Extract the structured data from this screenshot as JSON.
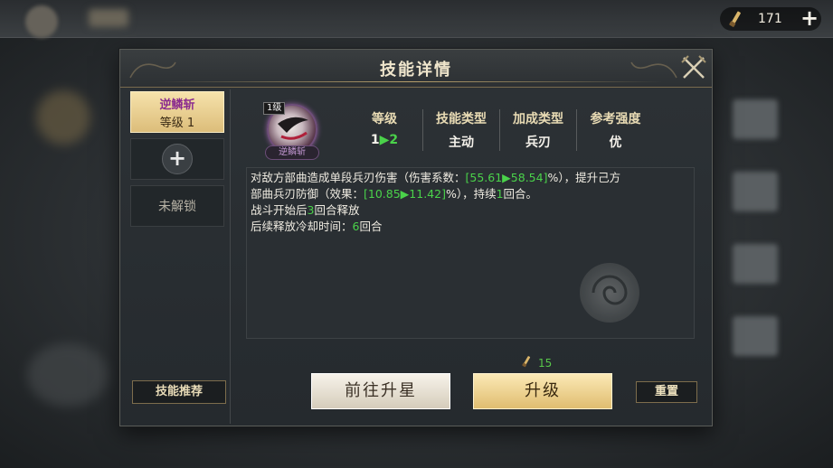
{
  "resource": {
    "icon": "brush-scroll-icon",
    "value": "171",
    "plus": "+"
  },
  "dialog": {
    "title": "技能详情",
    "close_icon": "crossed-blades-close-icon"
  },
  "left_panel": {
    "active_skill": {
      "name": "逆鳞斩",
      "level": "等级 1"
    },
    "add_symbol": "+",
    "locked_label": "未解锁",
    "recommend_label": "技能推荐"
  },
  "skill": {
    "level_badge": "1级",
    "icon_name": "逆鳞斩",
    "stats": [
      {
        "label": "等级",
        "value_from": "1",
        "value_to": "2"
      },
      {
        "label": "技能类型",
        "value": "主动"
      },
      {
        "label": "加成类型",
        "value": "兵刃"
      },
      {
        "label": "参考强度",
        "value": "优"
      }
    ],
    "description": {
      "line1_a": "对敌方部曲造成单段兵刃伤害（伤害系数：",
      "line1_hl": "[55.61▶58.54]",
      "line1_b": "%），提升己方",
      "line2_a": "部曲兵刃防御（效果：",
      "line2_hl": "[10.85▶11.42]",
      "line2_b": "%），持续",
      "line2_hl2": "1",
      "line2_c": "回合。",
      "line3_a": "战斗开始后",
      "line3_hl": "3",
      "line3_b": "回合释放",
      "line4_a": "后续释放冷却时间：",
      "line4_hl": "6",
      "line4_b": "回合"
    }
  },
  "cost": {
    "icon": "brush-scroll-icon",
    "value": "15"
  },
  "buttons": {
    "star_up": "前往升星",
    "upgrade": "升级",
    "reset": "重置"
  },
  "colors": {
    "accent_gold": "#e0bd70",
    "highlight_green": "#4ad24a",
    "skill_purple": "#8a2a8f"
  }
}
